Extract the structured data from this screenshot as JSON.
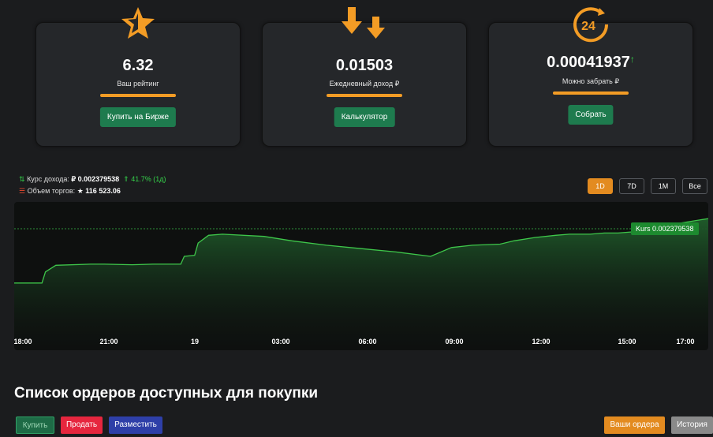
{
  "cards": [
    {
      "value": "6.32",
      "label": "Ваш рейтинг",
      "button": "Купить на Бирже",
      "icon": "star-icon"
    },
    {
      "value": "0.01503",
      "label": "Ежедневный доход ₽",
      "button": "Калькулятор",
      "icon": "arrows-down-icon"
    },
    {
      "value": "0.00041937",
      "value_arrow": "↑",
      "label": "Можно забрать ₽",
      "button": "Собрать",
      "icon": "clock-24-icon"
    }
  ],
  "stats": {
    "rate_label": "Курс дохода:",
    "rate_value": "₽ 0.002379538",
    "rate_change": "41.7% (1д)",
    "volume_label": "Объем торгов:",
    "volume_value": "116 523.06"
  },
  "ranges": [
    "1D",
    "7D",
    "1M",
    "Все"
  ],
  "active_range": "1D",
  "chart_data": {
    "type": "area",
    "x_ticks": [
      "18:00",
      "21:00",
      "19",
      "03:00",
      "06:00",
      "09:00",
      "12:00",
      "15:00",
      "17:00"
    ],
    "price_label": "Kurs 0.002379538",
    "x": [
      0,
      0.04,
      0.045,
      0.06,
      0.11,
      0.13,
      0.17,
      0.2,
      0.24,
      0.245,
      0.26,
      0.265,
      0.28,
      0.3,
      0.36,
      0.4,
      0.45,
      0.5,
      0.55,
      0.6,
      0.63,
      0.66,
      0.7,
      0.72,
      0.75,
      0.78,
      0.8,
      0.83,
      0.85,
      0.87,
      0.89,
      0.91,
      0.93,
      1.0
    ],
    "y": [
      0.42,
      0.42,
      0.52,
      0.58,
      0.59,
      0.59,
      0.585,
      0.59,
      0.59,
      0.66,
      0.67,
      0.78,
      0.85,
      0.86,
      0.84,
      0.8,
      0.76,
      0.73,
      0.7,
      0.66,
      0.74,
      0.76,
      0.77,
      0.8,
      0.83,
      0.85,
      0.86,
      0.86,
      0.87,
      0.87,
      0.88,
      0.89,
      0.93,
      1.0
    ],
    "ylim": [
      0,
      1.15
    ],
    "colors": {
      "line": "#3ec64a",
      "fill_top": "#1f5a2a",
      "fill_bottom": "#0e100f"
    }
  },
  "section_title": "Список ордеров доступных для покупки",
  "buttons": {
    "buy": "Купить",
    "sell": "Продать",
    "place": "Разместить",
    "my_orders": "Ваши ордера",
    "history": "История"
  },
  "colors": {
    "accent": "#f39c25",
    "green": "#1e7b4e",
    "red": "#e6263e",
    "blue": "#2e3fa8"
  }
}
